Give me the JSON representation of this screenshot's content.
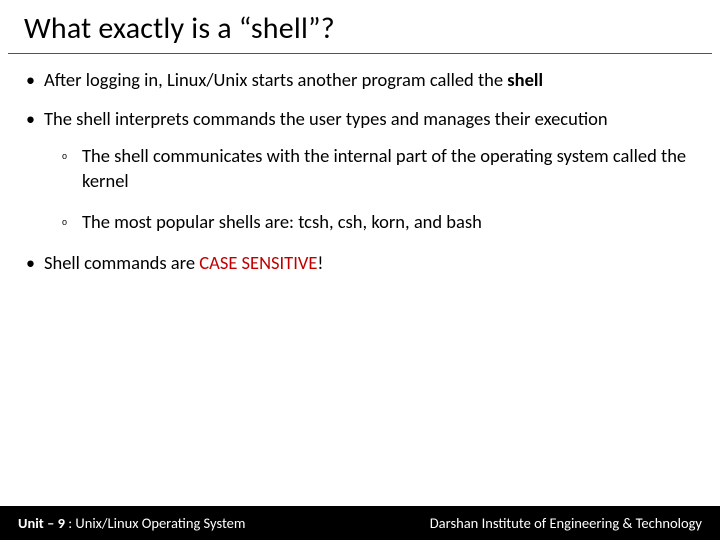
{
  "title": "What exactly is a “shell”?",
  "bullets": {
    "b1_pre": "After logging in, Linux/Unix starts another program called the ",
    "b1_bold": "shell",
    "b2": "The shell interprets commands the user types and manages their execution",
    "b2_sub1": "The shell communicates with the internal part of the operating system called the kernel",
    "b2_sub2": "The most popular shells are: tcsh, csh, korn, and bash",
    "b3_pre": "Shell commands are ",
    "b3_red": "CASE SENSITIVE",
    "b3_post": "!"
  },
  "footer": {
    "left_prefix": "Unit – 9",
    "left_rest": "  : Unix/Linux Operating System",
    "right": "Darshan Institute of Engineering & Technology"
  }
}
